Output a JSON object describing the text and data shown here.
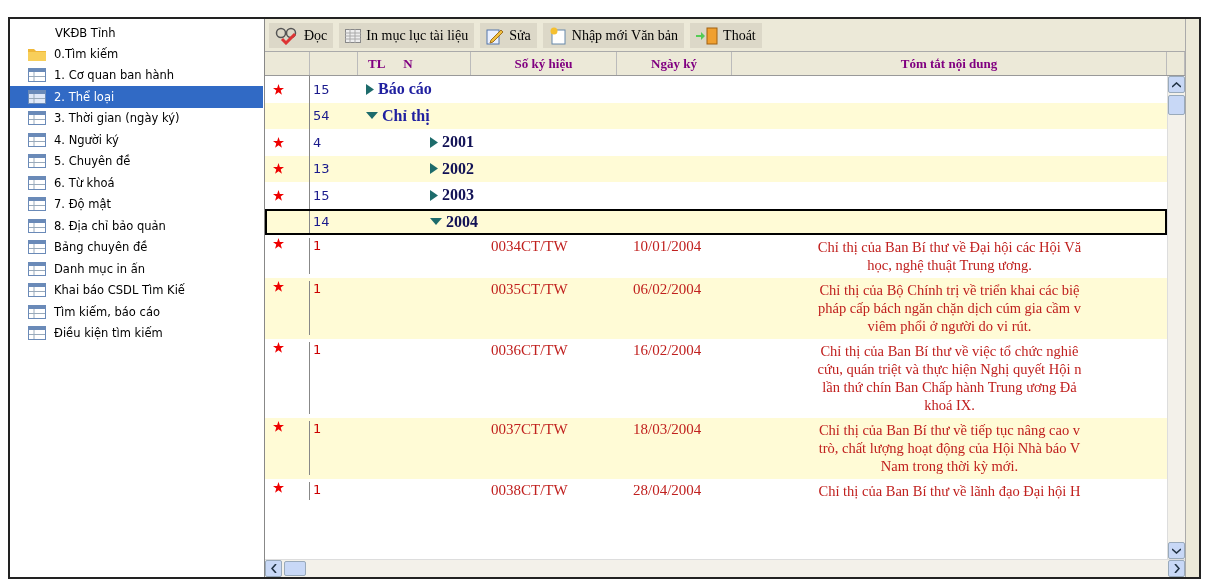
{
  "sidebar": {
    "title": "VKĐB Tỉnh",
    "items": [
      {
        "label": "0.Tìm kiếm",
        "kind": "folder",
        "selected": false
      },
      {
        "label": "1. Cơ quan ban hành",
        "kind": "table",
        "selected": false
      },
      {
        "label": "2. Thể loại",
        "kind": "table",
        "selected": true
      },
      {
        "label": "3. Thời gian (ngày ký)",
        "kind": "table",
        "selected": false
      },
      {
        "label": "4. Người ký",
        "kind": "table",
        "selected": false
      },
      {
        "label": "5. Chuyên đề",
        "kind": "table",
        "selected": false
      },
      {
        "label": "6. Từ khoá",
        "kind": "table",
        "selected": false
      },
      {
        "label": "7. Độ mật",
        "kind": "table",
        "selected": false
      },
      {
        "label": "8. Địa chỉ bảo quản",
        "kind": "table",
        "selected": false
      },
      {
        "label": "Bảng chuyên đề",
        "kind": "table",
        "selected": false
      },
      {
        "label": "Danh mục in ấn",
        "kind": "table",
        "selected": false
      },
      {
        "label": "Khai báo CSDL Tìm Kiế",
        "kind": "table",
        "selected": false
      },
      {
        "label": "Tìm kiếm, báo cáo",
        "kind": "table",
        "selected": false
      },
      {
        "label": "Điều kiện tìm kiếm",
        "kind": "table",
        "selected": false
      }
    ]
  },
  "toolbar": [
    {
      "label": "Đọc",
      "kind": "read"
    },
    {
      "label": "In mục lục tài liệu",
      "kind": "print"
    },
    {
      "label": "Sửa",
      "kind": "edit"
    },
    {
      "label": "Nhập mới Văn bản",
      "kind": "new"
    },
    {
      "label": "Thoát",
      "kind": "exit"
    }
  ],
  "table": {
    "columns": [
      "TL",
      "N",
      "Số ký hiệu",
      "Ngày ký",
      "Tóm tắt nội dung"
    ],
    "rows": [
      {
        "kind": "group",
        "count": "15",
        "label": "Báo cáo",
        "starred": true,
        "expanded": false,
        "selected": false
      },
      {
        "kind": "group",
        "count": "54",
        "label": "Chỉ thị",
        "starred": false,
        "expanded": true,
        "selected": false,
        "children": [
          {
            "kind": "group",
            "count": "4",
            "label": "2001",
            "starred": true,
            "expanded": false,
            "selected": false
          },
          {
            "kind": "group",
            "count": "13",
            "label": "2002",
            "starred": true,
            "expanded": false,
            "selected": false
          },
          {
            "kind": "group",
            "count": "15",
            "label": "2003",
            "starred": true,
            "expanded": false,
            "selected": false
          },
          {
            "kind": "group",
            "count": "14",
            "label": "2004",
            "starred": false,
            "expanded": true,
            "selected": true,
            "children": [
              {
                "kind": "document",
                "count": "1",
                "number": "0034CT/TW",
                "date": "10/01/2004",
                "starred": true,
                "selected": false,
                "summary": [
                  "Chỉ thị của Ban Bí thư về Đại hội các Hội Vă",
                  "học, nghệ thuật Trung ương."
                ]
              },
              {
                "kind": "document",
                "count": "1",
                "number": "0035CT/TW",
                "date": "06/02/2004",
                "starred": true,
                "selected": false,
                "summary": [
                  "Chỉ thị của Bộ Chính trị về triển khai các biệ",
                  "pháp cấp bách ngăn chặn dịch cúm gia cầm v",
                  "viêm phổi ở người do vi rút."
                ]
              },
              {
                "kind": "document",
                "count": "1",
                "number": "0036CT/TW",
                "date": "16/02/2004",
                "starred": true,
                "selected": false,
                "summary": [
                  "Chỉ thị của Ban Bí thư về việc tổ chức nghiê",
                  "cứu, quán triệt và thực hiện Nghị quyết Hội n",
                  "lần thứ chín Ban Chấp hành Trung ương Đả",
                  "khoá IX."
                ]
              },
              {
                "kind": "document",
                "count": "1",
                "number": "0037CT/TW",
                "date": "18/03/2004",
                "starred": true,
                "selected": false,
                "summary": [
                  "Chỉ thị của Ban Bí thư về tiếp tục nâng cao v",
                  "trò, chất lượng hoạt động của Hội Nhà báo V",
                  "Nam trong thời kỳ mới."
                ]
              },
              {
                "kind": "document",
                "count": "1",
                "number": "0038CT/TW",
                "date": "28/04/2004",
                "starred": true,
                "selected": false,
                "summary": [
                  "Chỉ thị của Ban Bí thư về lãnh đạo Đại hội H"
                ]
              }
            ]
          }
        ]
      }
    ]
  }
}
